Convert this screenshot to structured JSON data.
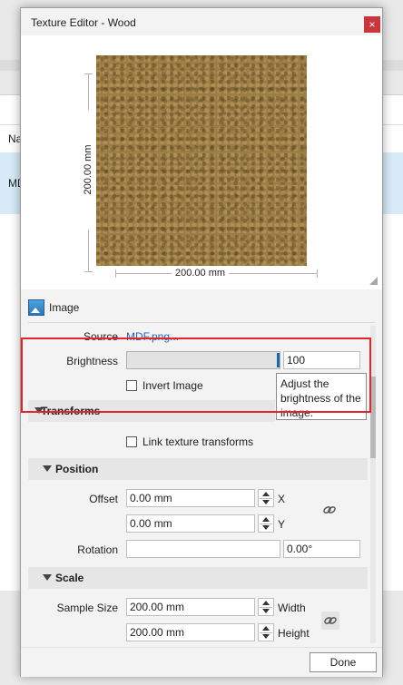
{
  "background_app": {
    "col_header_fragment": "Na",
    "row_fragment": "MD"
  },
  "dialog": {
    "title": "Texture Editor - Wood",
    "close_glyph": "×"
  },
  "preview": {
    "height_label": "200.00 mm",
    "width_label": "200.00 mm"
  },
  "image_section": {
    "icon": "image-icon",
    "label": "Image",
    "source_label": "Source",
    "source_value": "MDF.png...",
    "brightness_label": "Brightness",
    "brightness_value": "100",
    "invert_label": "Invert Image",
    "invert_checked": false,
    "tooltip": "Adjust the brightness of the image."
  },
  "transforms": {
    "header": "Transforms",
    "link_label": "Link texture transforms",
    "link_checked": false
  },
  "position": {
    "header": "Position",
    "offset_label": "Offset",
    "offset_x": "0.00 mm",
    "offset_x_axis": "X",
    "offset_y": "0.00 mm",
    "offset_y_axis": "Y",
    "rotation_label": "Rotation",
    "rotation_value": "0.00°"
  },
  "scale": {
    "header": "Scale",
    "sample_size_label": "Sample Size",
    "width_value": "200.00 mm",
    "width_label": "Width",
    "height_value": "200.00 mm",
    "height_label": "Height"
  },
  "footer": {
    "done_label": "Done"
  },
  "colors": {
    "accent": "#1f64b3",
    "highlight": "#e0252d",
    "close": "#c9353a",
    "texture": "#9c7d45"
  }
}
